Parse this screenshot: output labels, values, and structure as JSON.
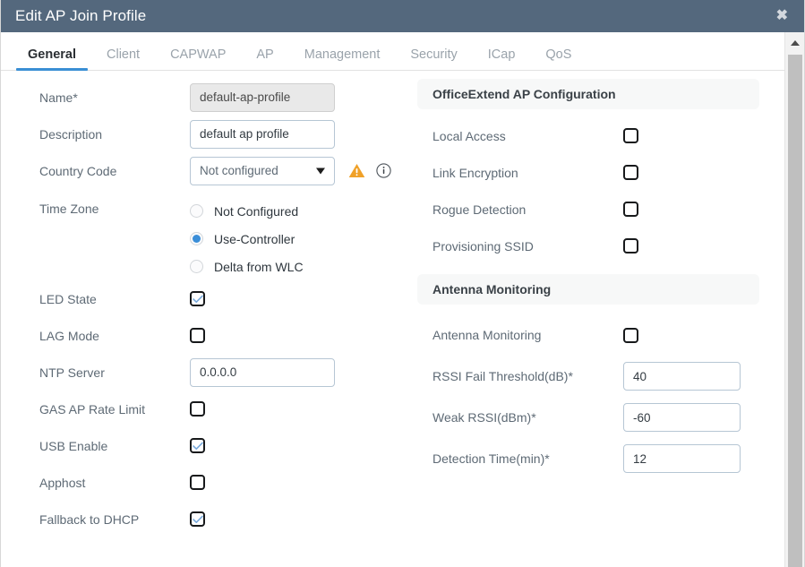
{
  "window": {
    "title": "Edit AP Join Profile",
    "close_label": "✖"
  },
  "tabs": [
    {
      "label": "General",
      "active": true
    },
    {
      "label": "Client",
      "active": false
    },
    {
      "label": "CAPWAP",
      "active": false
    },
    {
      "label": "AP",
      "active": false
    },
    {
      "label": "Management",
      "active": false
    },
    {
      "label": "Security",
      "active": false
    },
    {
      "label": "ICap",
      "active": false
    },
    {
      "label": "QoS",
      "active": false
    }
  ],
  "left": {
    "name": {
      "label": "Name*",
      "value": "default-ap-profile",
      "placeholder": ""
    },
    "description": {
      "label": "Description",
      "value": "default ap profile",
      "placeholder": ""
    },
    "country_code": {
      "label": "Country Code",
      "value": "Not configured",
      "options": [
        "Not configured"
      ],
      "warning_icon": "warning-triangle-icon",
      "info_icon": "info-circle-icon"
    },
    "time_zone": {
      "label": "Time Zone",
      "options": [
        {
          "label": "Not Configured",
          "selected": false
        },
        {
          "label": "Use-Controller",
          "selected": true
        },
        {
          "label": "Delta from WLC",
          "selected": false
        }
      ]
    },
    "led_state": {
      "label": "LED State",
      "checked": true
    },
    "lag_mode": {
      "label": "LAG Mode",
      "checked": false
    },
    "ntp_server": {
      "label": "NTP Server",
      "value": "0.0.0.0",
      "placeholder": ""
    },
    "gas_ap_rate_limit": {
      "label": "GAS AP Rate Limit",
      "checked": false
    },
    "usb_enable": {
      "label": "USB Enable",
      "checked": true
    },
    "apphost": {
      "label": "Apphost",
      "checked": false
    },
    "fallback_to_dhcp": {
      "label": "Fallback to DHCP",
      "checked": true
    }
  },
  "right": {
    "officeextend": {
      "section_title": "OfficeExtend AP Configuration",
      "local_access": {
        "label": "Local Access",
        "checked": false
      },
      "link_encryption": {
        "label": "Link Encryption",
        "checked": false
      },
      "rogue_detection": {
        "label": "Rogue Detection",
        "checked": false
      },
      "provisioning_ssid": {
        "label": "Provisioning SSID",
        "checked": false
      }
    },
    "antenna": {
      "section_title": "Antenna Monitoring",
      "antenna_monitoring": {
        "label": "Antenna Monitoring",
        "checked": false
      },
      "rssi_fail_threshold": {
        "label": "RSSI Fail Threshold(dB)*",
        "value": "40",
        "placeholder": ""
      },
      "weak_rssi": {
        "label": "Weak RSSI(dBm)*",
        "value": "-60",
        "placeholder": ""
      },
      "detection_time": {
        "label": "Detection Time(min)*",
        "value": "12",
        "placeholder": ""
      }
    }
  },
  "colors": {
    "titlebar": "#54687d",
    "accent": "#3a8fd4",
    "warning": "#f0a128",
    "checkmark": "#79aadc",
    "radio_on": "#3b8ed8"
  }
}
